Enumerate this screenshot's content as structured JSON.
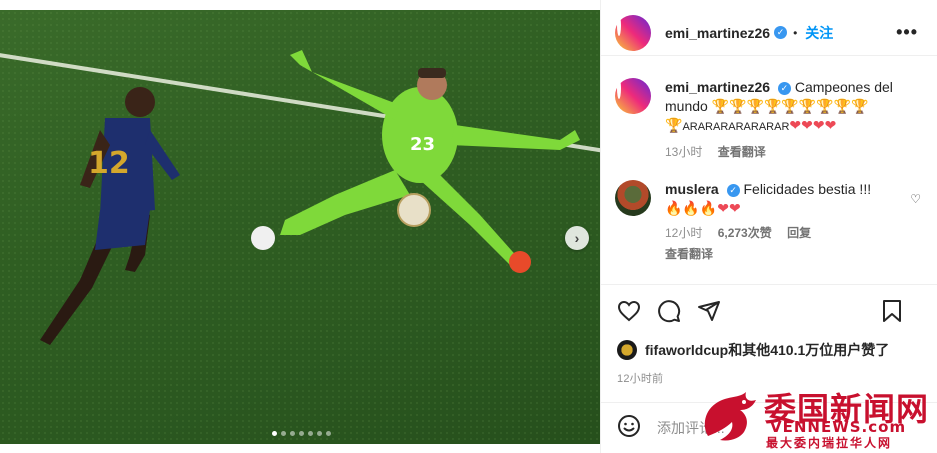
{
  "post": {
    "username": "emi_martinez26",
    "follow_label": "关注",
    "more_label": "•••"
  },
  "caption": {
    "username": "emi_martinez26",
    "text_line1": "Campeones del mundo 🏆🏆🏆🏆🏆🏆🏆🏆🏆",
    "text_line2_prefix": "🏆",
    "text_line2_shout": "ARARARARARARAR",
    "text_line2_hearts": "❤❤❤❤",
    "time": "13小时",
    "translate": "查看翻译"
  },
  "comment": {
    "username": "muslera",
    "text": "Felicidades bestia !!!",
    "emoji": "🔥🔥🔥❤❤",
    "time": "12小时",
    "likes": "6,273次赞",
    "reply": "回复",
    "translate": "查看翻译"
  },
  "likes": {
    "text": "fifaworldcup和其他410.1万位用户赞了"
  },
  "timestamp": "12小时前",
  "add_comment": {
    "placeholder": "添加评论..."
  },
  "carousel": {
    "total_slides": 7,
    "current_slide": 1
  },
  "watermark": {
    "title": "委国新闻网",
    "domain": "VENNEWS.com",
    "subtitle": "最大委内瑞拉华人网"
  },
  "colors": {
    "link_blue": "#0095f6",
    "verified_blue": "#3897f0",
    "heart_red": "#ed4956",
    "watermark_red": "#c8102e"
  }
}
